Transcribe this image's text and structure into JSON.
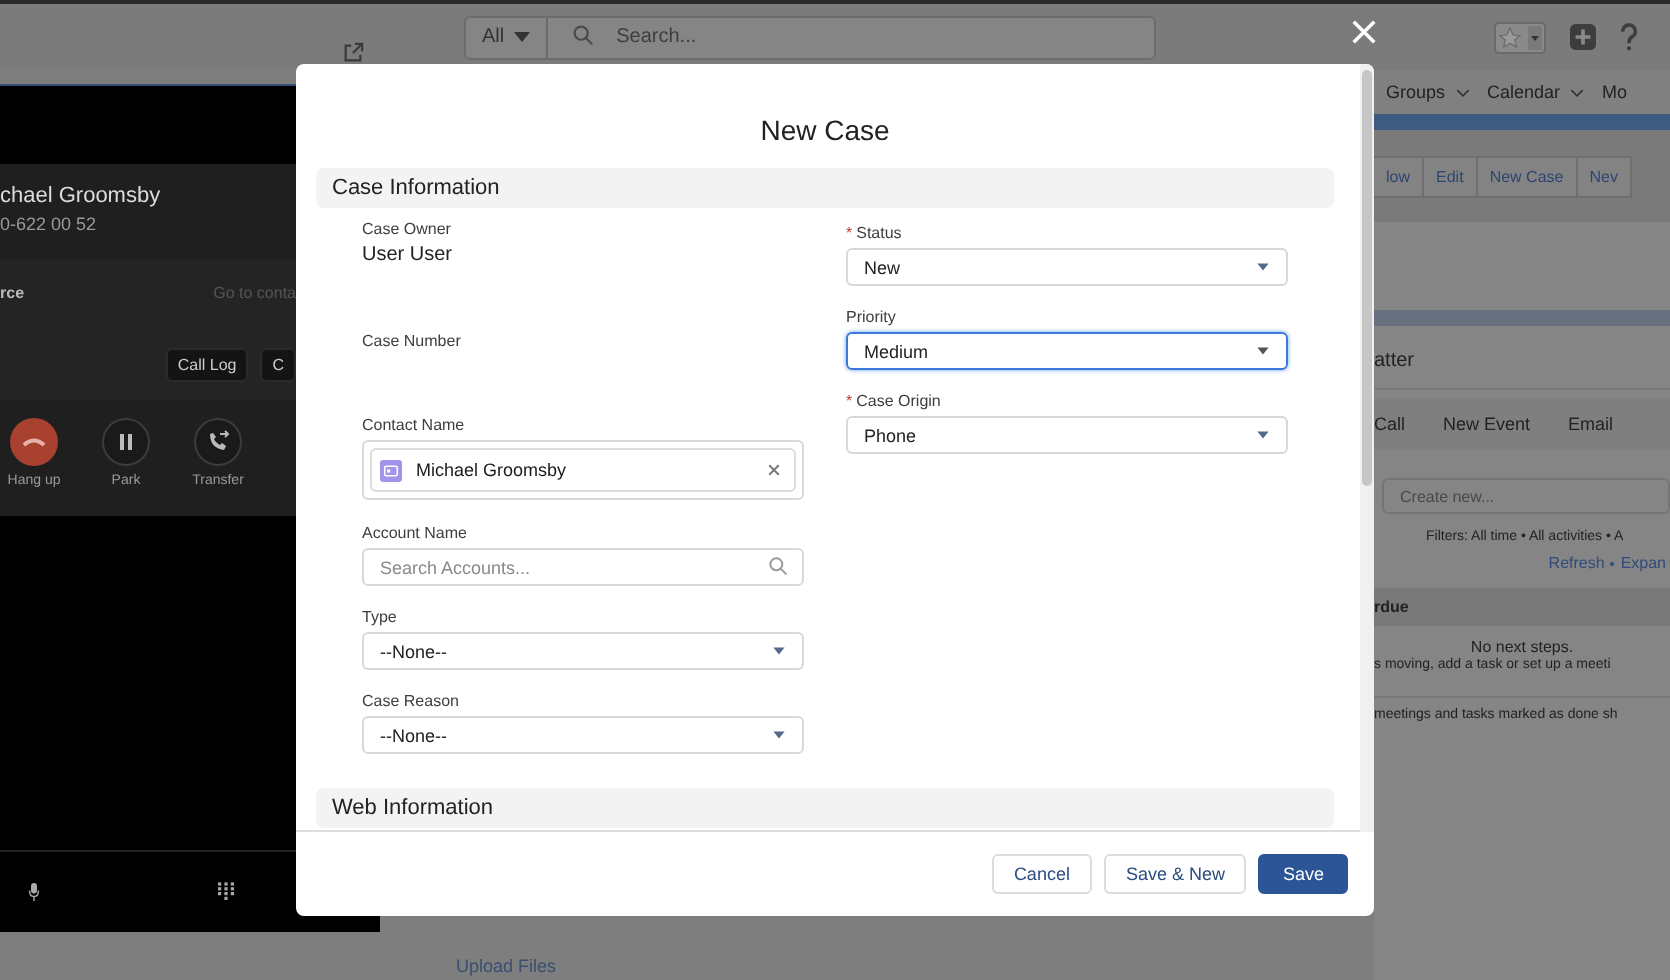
{
  "global_header": {
    "scope_menu": "All",
    "search": {
      "placeholder": "Search..."
    }
  },
  "softphone": {
    "contact_name": "chael Groomsby",
    "phone": "0-622 00 52",
    "source": "rce",
    "link": "Go to conta",
    "buttons": [
      "Call Log",
      "C"
    ],
    "actions": [
      {
        "label": "Hang up",
        "kind": "hangup"
      },
      {
        "label": "Park",
        "kind": "pause"
      },
      {
        "label": "Transfer",
        "kind": "transfer"
      }
    ]
  },
  "nav_tabs": [
    {
      "label": "Groups",
      "menu": true
    },
    {
      "label": "Calendar",
      "menu": true
    },
    {
      "label": "Mo",
      "menu": false
    }
  ],
  "record_actions": [
    "low",
    "Edit",
    "New Case",
    "Nev"
  ],
  "chatter": {
    "title": "atter",
    "tabs": [
      "Call",
      "New Event",
      "Email"
    ],
    "composer": {
      "placeholder": "Create new..."
    },
    "filters": "Filters: All time • All activities • A",
    "links": [
      "Refresh",
      "Expan"
    ],
    "section": "rdue",
    "empty_title": "No next steps.",
    "empty_hint": "s moving, add a task or set up a meeti",
    "past_hint": "meetings and tasks marked as done sh"
  },
  "upload_link": "Upload Files",
  "modal": {
    "title": "New Case",
    "required_mark": "*",
    "sections": [
      {
        "title": "Case Information"
      },
      {
        "title": "Web Information"
      }
    ],
    "left_fields": [
      {
        "label": "Case Owner",
        "kind": "text",
        "value": "User User"
      },
      {
        "label": "Case Number",
        "kind": "text"
      },
      {
        "label": "Contact Name",
        "kind": "lookup",
        "value": "Michael Groomsby"
      },
      {
        "label": "Account Name",
        "kind": "search",
        "placeholder": "Search Accounts..."
      },
      {
        "label": "Type",
        "kind": "select",
        "value": "--None--",
        "focused": false
      },
      {
        "label": "Case Reason",
        "kind": "select",
        "value": "--None--",
        "focused": false
      }
    ],
    "right_fields": [
      {
        "label": "Status",
        "kind": "select",
        "required": true,
        "value": "New",
        "focused": false
      },
      {
        "label": "Priority",
        "kind": "select",
        "required": false,
        "value": "Medium",
        "focused": true
      },
      {
        "label": "Case Origin",
        "kind": "select",
        "required": true,
        "value": "Phone",
        "focused": false
      }
    ],
    "buttons": [
      {
        "label": "Cancel",
        "kind": "neutral"
      },
      {
        "label": "Save & New",
        "kind": "neutral"
      },
      {
        "label": "Save",
        "kind": "brand"
      }
    ]
  }
}
